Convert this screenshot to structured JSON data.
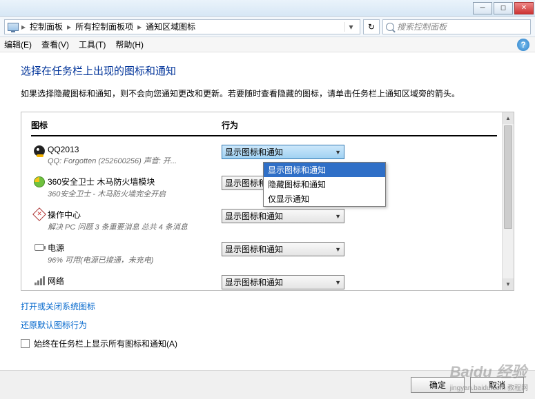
{
  "address": {
    "crumbs": [
      "控制面板",
      "所有控制面板项",
      "通知区域图标"
    ],
    "search_placeholder": "搜索控制面板"
  },
  "menus": [
    "编辑(E)",
    "查看(V)",
    "工具(T)",
    "帮助(H)"
  ],
  "page": {
    "title": "选择在任务栏上出现的图标和通知",
    "desc": "如果选择隐藏图标和通知，则不会向您通知更改和更新。若要随时查看隐藏的图标，请单击任务栏上通知区域旁的箭头。"
  },
  "headers": {
    "icon": "图标",
    "behavior": "行为"
  },
  "options": [
    "显示图标和通知",
    "隐藏图标和通知",
    "仅显示通知"
  ],
  "rows": [
    {
      "name": "QQ2013",
      "sub": "QQ:  Forgotten          (252600256)  声音: 开...",
      "value": "显示图标和通知",
      "icon": "qq",
      "open": true
    },
    {
      "name": "360安全卫士 木马防火墙模块",
      "sub": "360安全卫士 - 木马防火墙完全开启",
      "value": "显示图标和通知",
      "icon": "360"
    },
    {
      "name": "操作中心",
      "sub": "解决 PC 问题   3 条重要消息  总共 4 条消息",
      "value": "显示图标和通知",
      "icon": "action"
    },
    {
      "name": "电源",
      "sub": "96% 可用(电源已接通，未充电)",
      "value": "显示图标和通知",
      "icon": "power"
    },
    {
      "name": "网络",
      "sub": "",
      "value": "显示图标和通知",
      "icon": "net"
    }
  ],
  "links": {
    "systemIcons": "打开或关闭系统图标",
    "restoreDefault": "还原默认图标行为"
  },
  "checkbox": "始终在任务栏上显示所有图标和通知(A)",
  "buttons": {
    "ok": "确定",
    "cancel": "取消"
  },
  "watermark": {
    "main": "Baidu 经验",
    "sub": "jingyan.baidu.com   教程网"
  }
}
